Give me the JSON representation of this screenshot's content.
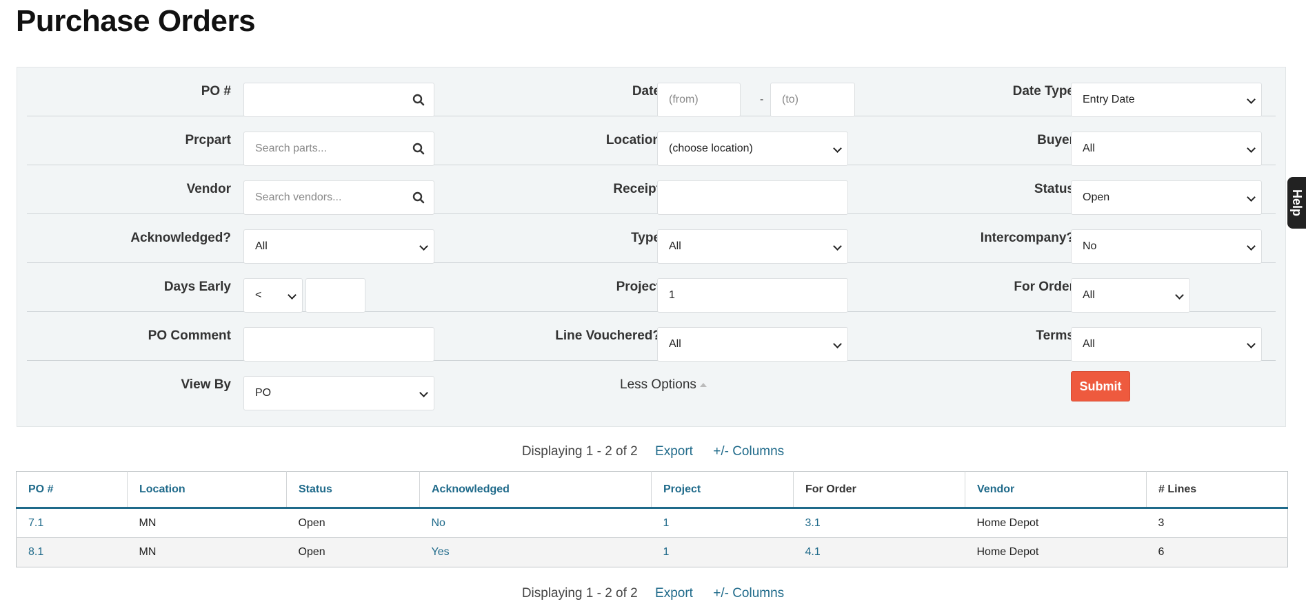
{
  "page": {
    "title": "Purchase Orders"
  },
  "filters": {
    "po_number": {
      "label": "PO #",
      "value": "",
      "placeholder": ""
    },
    "date": {
      "label": "Date",
      "from_placeholder": "(from)",
      "to_placeholder": "(to)",
      "separator": "-"
    },
    "date_type": {
      "label": "Date Type",
      "selected": "Entry Date"
    },
    "prcpart": {
      "label": "Prcpart",
      "placeholder": "Search parts..."
    },
    "location": {
      "label": "Location",
      "selected": "(choose location)"
    },
    "buyer": {
      "label": "Buyer",
      "selected": "All"
    },
    "vendor": {
      "label": "Vendor",
      "placeholder": "Search vendors..."
    },
    "receipt": {
      "label": "Receipt",
      "value": ""
    },
    "status": {
      "label": "Status",
      "selected": "Open"
    },
    "acknowledged": {
      "label": "Acknowledged?",
      "selected": "All"
    },
    "type": {
      "label": "Type",
      "selected": "All"
    },
    "intercompany": {
      "label": "Intercompany?",
      "selected": "No"
    },
    "days_early": {
      "label": "Days Early",
      "operator": "<",
      "value": ""
    },
    "project": {
      "label": "Project",
      "value": "1"
    },
    "for_order": {
      "label": "For Order",
      "selected": "All"
    },
    "po_comment": {
      "label": "PO Comment",
      "value": ""
    },
    "line_vouchered": {
      "label": "Line Vouchered?",
      "selected": "All"
    },
    "terms": {
      "label": "Terms",
      "selected": "All"
    },
    "view_by": {
      "label": "View By",
      "selected": "PO"
    },
    "less_options": "Less Options",
    "submit": "Submit"
  },
  "help_tab": "Help",
  "pager": {
    "text": "Displaying 1 - 2 of 2",
    "export": "Export",
    "columns": "+/- Columns"
  },
  "table": {
    "headers": [
      "PO #",
      "Location",
      "Status",
      "Acknowledged",
      "Project",
      "For Order",
      "Vendor",
      "# Lines"
    ],
    "rows": [
      [
        "7.1",
        "MN",
        "Open",
        "No",
        "1",
        "3.1",
        "Home Depot",
        "3"
      ],
      [
        "8.1",
        "MN",
        "Open",
        "Yes",
        "1",
        "4.1",
        "Home Depot",
        "6"
      ]
    ]
  },
  "colors": {
    "accent": "#1f6a8a",
    "submit": "#ee5a3e",
    "panel": "#f2f5f6"
  }
}
